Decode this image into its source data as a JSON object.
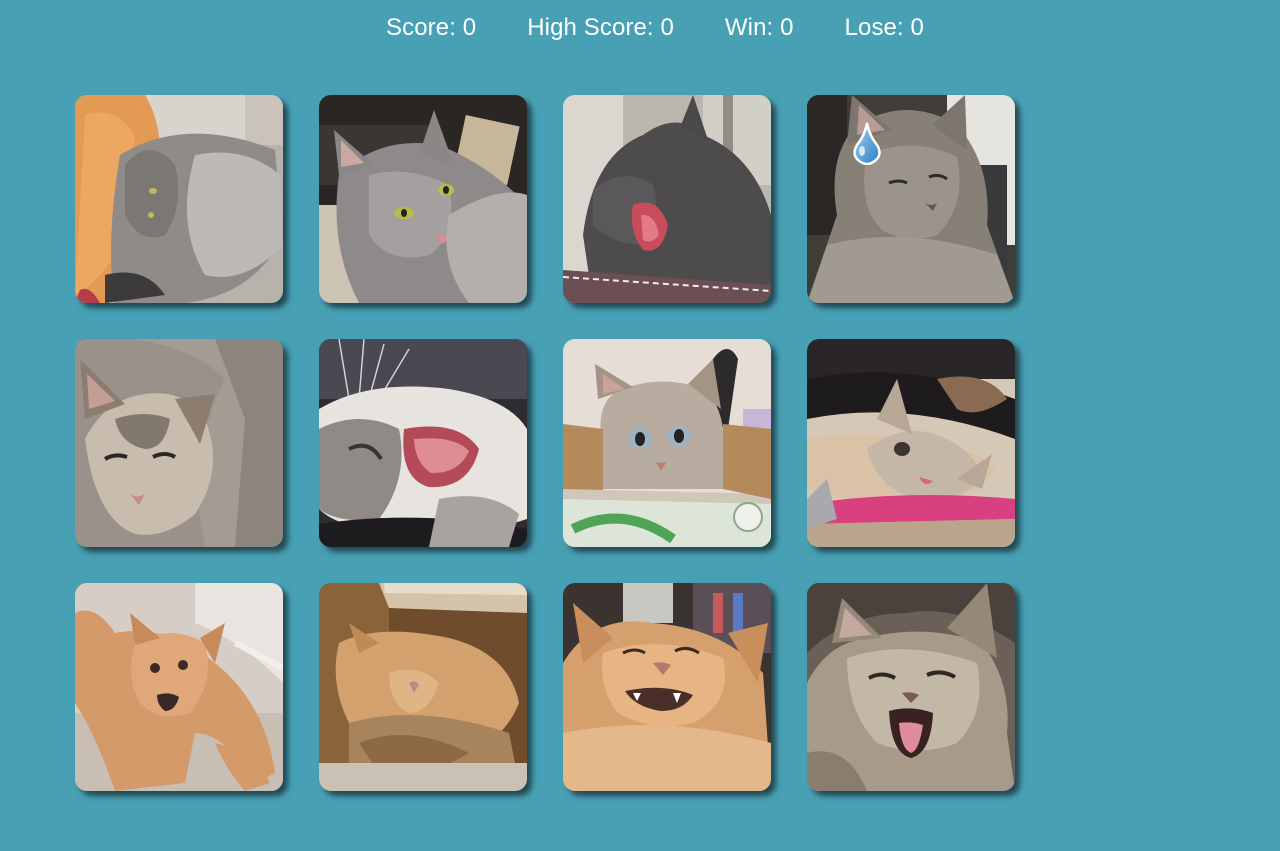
{
  "scoreboard": {
    "score": "Score: 0",
    "high_score": "High Score: 0",
    "win": "Win: 0",
    "lose": "Lose: 0"
  },
  "colors": {
    "background": "#48a0b5",
    "text": "#ffffff"
  },
  "cards": [
    {
      "name": "card-1",
      "icon": "cat-photo-gray-fluffy-lying"
    },
    {
      "name": "card-2",
      "icon": "cat-photo-gray-looking"
    },
    {
      "name": "card-3",
      "icon": "cat-photo-dark-yawning"
    },
    {
      "name": "card-4",
      "icon": "cat-photo-gray-squinting",
      "overlay": "water-drop-icon"
    },
    {
      "name": "card-5",
      "icon": "cat-photo-siamese-blanket"
    },
    {
      "name": "card-6",
      "icon": "cat-photo-white-yawning"
    },
    {
      "name": "card-7",
      "icon": "cat-photo-tabby-in-box"
    },
    {
      "name": "card-8",
      "icon": "cat-photo-lying-scratcher"
    },
    {
      "name": "card-9",
      "icon": "cat-photo-orange-kitten"
    },
    {
      "name": "card-10",
      "icon": "cat-photo-orange-in-box"
    },
    {
      "name": "card-11",
      "icon": "cat-photo-orange-closeup"
    },
    {
      "name": "card-12",
      "icon": "cat-photo-tabby-yawning"
    }
  ]
}
